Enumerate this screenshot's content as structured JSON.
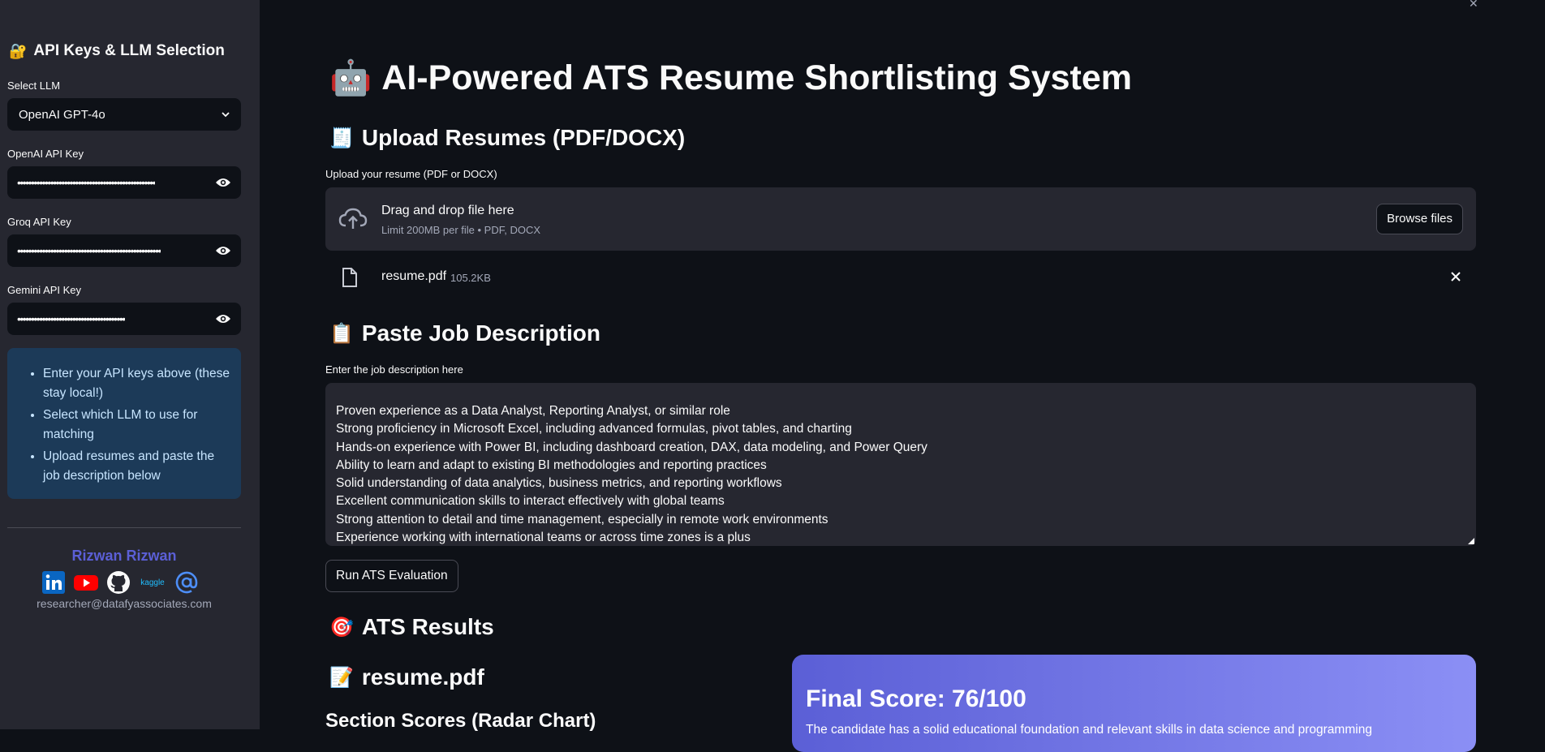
{
  "sidebar": {
    "title": "API Keys & LLM Selection",
    "title_icon": "lock-key-icon",
    "select_llm_label": "Select LLM",
    "select_llm_value": "OpenAI GPT-4o",
    "openai_label": "OpenAI API Key",
    "openai_value": "••••••••••••••••••••••••••••••••••••••••••••••••••",
    "groq_label": "Groq API Key",
    "groq_value": "••••••••••••••••••••••••••••••••••••••••••••••••••••",
    "gemini_label": "Gemini API Key",
    "gemini_value": "•••••••••••••••••••••••••••••••••••••••",
    "info_items": [
      "Enter your API keys above (these stay local!)",
      "Select which LLM to use for matching",
      "Upload resumes and paste the job description below"
    ],
    "author": "Rizwan Rizwan",
    "socials": {
      "linkedin": "linkedin-icon",
      "youtube": "youtube-icon",
      "github": "github-icon",
      "kaggle": "kaggle",
      "email": "at-sign-icon"
    },
    "email": "researcher@datafyassociates.com"
  },
  "main": {
    "title": "AI-Powered ATS Resume Shortlisting System",
    "title_icon": "robot-icon",
    "upload_heading": "Upload Resumes (PDF/DOCX)",
    "upload_heading_icon": "receipt-icon",
    "upload_label": "Upload your resume (PDF or DOCX)",
    "drag_title": "Drag and drop file here",
    "drag_sub": "Limit 200MB per file • PDF, DOCX",
    "browse_label": "Browse files",
    "file_name": "resume.pdf",
    "file_size": "105.2KB",
    "jd_heading": "Paste Job Description",
    "jd_heading_icon": "clipboard-icon",
    "jd_label": "Enter the job description here",
    "jd_lines": [
      "Proven experience as a Data Analyst, Reporting Analyst, or similar role",
      "Strong proficiency in Microsoft Excel, including advanced formulas, pivot tables, and charting",
      "Hands-on experience with Power BI, including dashboard creation, DAX, data modeling, and Power Query",
      "Ability to learn and adapt to existing BI methodologies and reporting practices",
      "Solid understanding of data analytics, business metrics, and reporting workflows",
      "Excellent communication skills to interact effectively with global teams",
      "Strong attention to detail and time management, especially in remote work environments",
      "Experience working with international teams or across time zones is a plus"
    ],
    "run_label": "Run ATS Evaluation",
    "results_heading": "ATS Results",
    "results_heading_icon": "target-icon",
    "resume_heading": "resume.pdf",
    "resume_heading_icon": "memo-icon",
    "section_scores_heading": "Section Scores (Radar Chart)",
    "final_score": "Final Score: 76/100",
    "final_desc": "The candidate has a solid educational foundation and relevant skills in data science and programming"
  }
}
